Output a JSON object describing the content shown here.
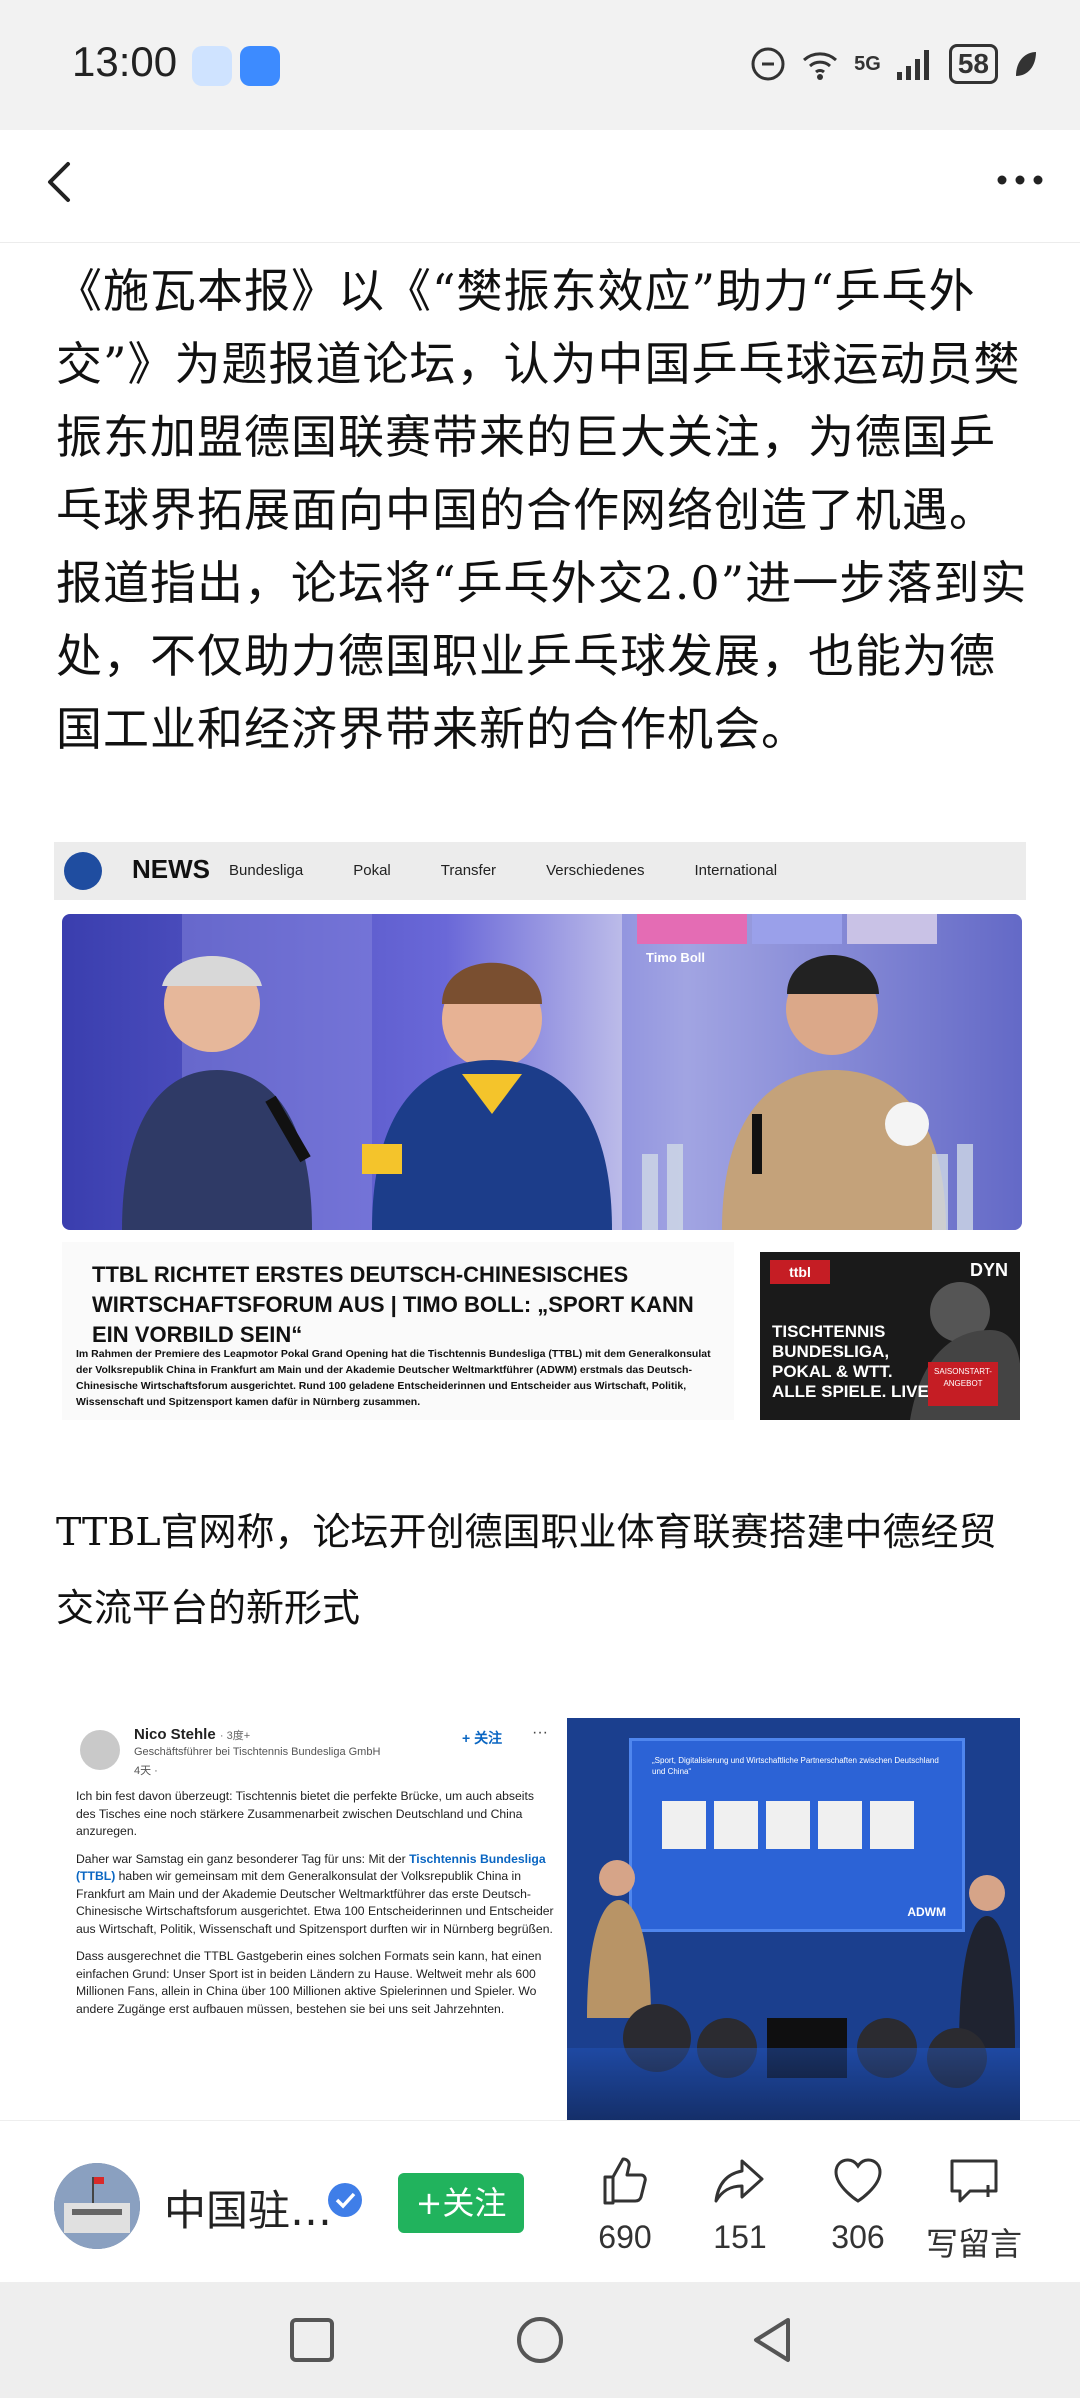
{
  "status_bar": {
    "time": "13:00",
    "signal": "5G",
    "battery": "58"
  },
  "article": {
    "paragraph1": "《施瓦本报》以《“樊振东效应”助力“乒乓外交”》为题报道论坛，认为中国乒乓球运动员樊振东加盟德国联赛带来的巨大关注，为德国乒乓球界拓展面向中国的合作网络创造了机遇。报道指出，论坛将“乒乓外交2.0”进一步落到实处，不仅助力德国职业乒乓球发展，也能为德国工业和经济界带来新的合作机会。",
    "paragraph2": "TTBL官网称，论坛开创德国职业体育联赛搭建中德经贸交流平台的新形式"
  },
  "image1": {
    "news_label": "NEWS",
    "nav_items": [
      "Bundesliga",
      "Pokal",
      "Transfer",
      "Verschiedenes",
      "International"
    ],
    "headline": "TTBL RICHTET ERSTES DEUTSCH-CHINESISCHES WIRTSCHAFTSFORUM AUS | TIMO BOLL: „SPORT KANN EIN VORBILD SEIN“",
    "body": "Im Rahmen der Premiere des Leapmotor Pokal Grand Opening hat die Tischtennis Bundesliga (TTBL) mit dem Generalkonsulat der Volksrepublik China in Frankfurt am Main und der Akademie Deutscher Weltmarktführer (ADWM) erstmals das Deutsch-Chinesische Wirtschaftsforum ausgerichtet. Rund 100 geladene Entscheiderinnen und Entscheider aus Wirtschaft, Politik, Wissenschaft und Spitzensport kamen dafür in Nürnberg zusammen.",
    "ad_brand": "ttbl",
    "ad_partner": "DYN",
    "ad_text": "TISCHTENNIS BUNDESLIGA, POKAL & WTT. ALLE SPIELE. LIVE",
    "ad_badge": "SAISONSTART-ANGEBOT",
    "stage_names": [
      "Timo Boll"
    ]
  },
  "image2": {
    "name": "Nico Stehle",
    "degree": "· 3度+",
    "role": "Geschäftsführer bei Tischtennis Bundesliga GmbH",
    "time": "4天 · ",
    "follow": "+ 关注",
    "dots": "···",
    "p1": "Ich bin fest davon überzeugt: Tischtennis bietet die perfekte Brücke, um auch abseits des Tisches eine noch stärkere Zusammenarbeit zwischen Deutschland und China anzuregen.",
    "p2a": "Daher war Samstag ein ganz besonderer Tag für uns: Mit der ",
    "p2link": "Tischtennis Bundesliga (TTBL)",
    "p2b": " haben wir gemeinsam mit dem Generalkonsulat der Volksrepublik China in Frankfurt am Main und der Akademie Deutscher Weltmarktführer das erste Deutsch-Chinesische Wirtschaftsforum ausgerichtet. Etwa 100 Entscheiderinnen und Entscheider aus Wirtschaft, Politik, Wissenschaft und Spitzensport durften wir in Nürnberg begrüßen.",
    "p3": "Dass ausgerechnet die TTBL Gastgeberin eines solchen Formats sein kann, hat einen einfachen Grund: Unser Sport ist in beiden Ländern zu Hause. Weltweit mehr als 600 Millionen Fans, allein in China über 100 Millionen aktive Spielerinnen und Spieler. Wo andere Zugänge erst aufbauen müssen, bestehen sie bei uns seit Jahrzehnten.",
    "screen_title": "„Sport, Digitalisierung und Wirtschaftliche Partnerschaften zwischen Deutschland und China“",
    "screen_logo": "ADWM"
  },
  "bottom": {
    "account": "中国驻…",
    "follow": "+关注",
    "likes": "690",
    "shares": "151",
    "favorites": "306",
    "comment": "写留言"
  }
}
